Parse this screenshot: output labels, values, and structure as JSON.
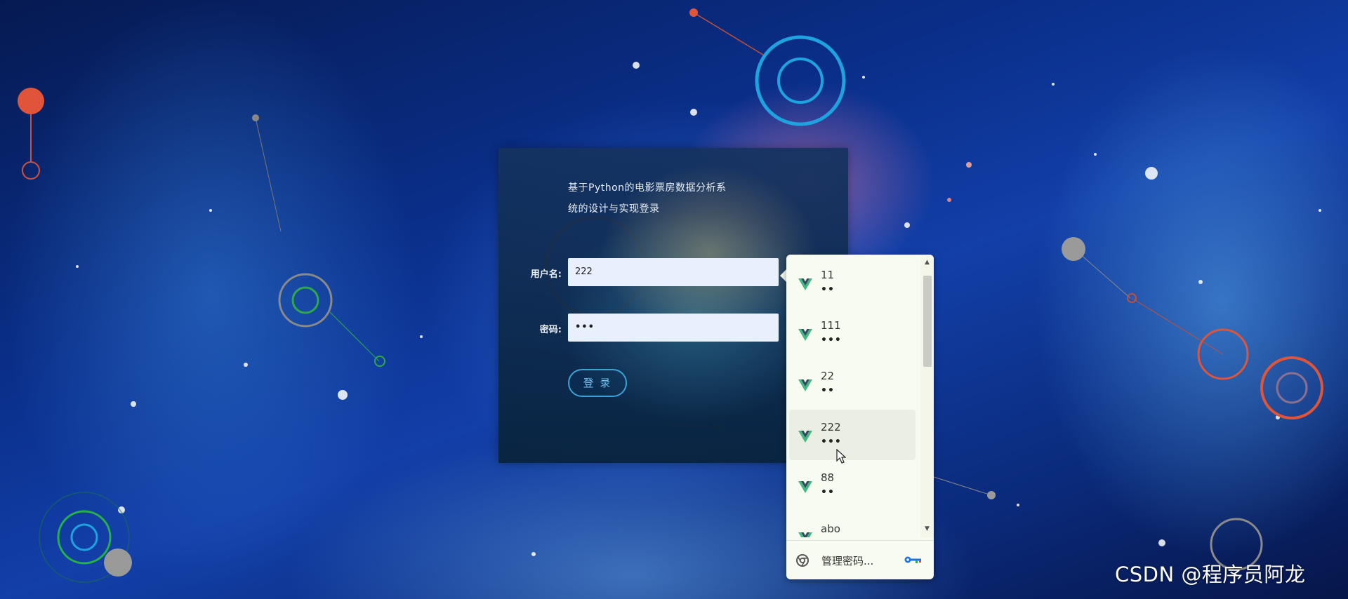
{
  "login": {
    "title_line1": "基于Python的电影票房数据分析系",
    "title_line2": "统的设计与实现登录",
    "username_label": "用户名:",
    "username_value": "222",
    "password_label": "密码:",
    "password_value": "•••",
    "login_button": "登 录"
  },
  "autofill": {
    "items": [
      {
        "username": "11",
        "password": "••"
      },
      {
        "username": "111",
        "password": "•••"
      },
      {
        "username": "22",
        "password": "••"
      },
      {
        "username": "222",
        "password": "•••"
      },
      {
        "username": "88",
        "password": "••"
      },
      {
        "username": "abo",
        "password": ""
      }
    ],
    "hovered_username": "222",
    "manage_label": "管理密码...",
    "icon": "vue-logo-icon"
  },
  "watermark": "CSDN @程序员阿龙",
  "colors": {
    "accent": "#3aa3d8",
    "vue_green": "#41b883",
    "vue_dark": "#35495e"
  }
}
